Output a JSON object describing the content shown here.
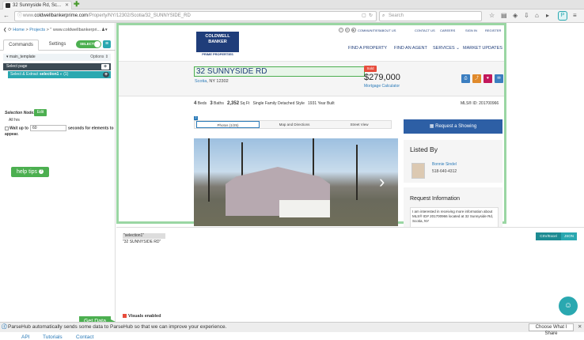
{
  "browser": {
    "tab_title": "32 Sunnyside Rd, Sc...",
    "url_prefix": "www.",
    "url_domain": "coldwellbankerprime.com",
    "url_path": "/Property/NY/12302/Scotia/32_SUNNYSIDE_RD",
    "search_placeholder": "Search"
  },
  "sidebar": {
    "breadcrumb_home": "Home",
    "breadcrumb_sep": " > ",
    "breadcrumb_projects": "Projects",
    "breadcrumb_current": " > \" www.coldwellbankerpri...",
    "tabs": [
      "Commands",
      "Settings"
    ],
    "select_toggle": "SELECT",
    "template_name": "main_template",
    "options_label": "Options ⇕",
    "command_1": "Select page",
    "command_2_prefix": "Select & Extract ",
    "command_2_name": "selection1",
    "command_2_count": "(1)",
    "selection_node_label": "Selection Node:",
    "edit_label": "Edit",
    "all_hrs": "All hrs",
    "wait_label": "Wait up to",
    "wait_value": "60",
    "wait_suffix": "seconds for elements to appear.",
    "help_tips": "help tips",
    "get_data": "Get Data",
    "footer_links": [
      "API",
      "Tutorials",
      "Contact"
    ]
  },
  "site": {
    "logo_line1": "COLDWELL",
    "logo_line2": "BANKER",
    "logo_line3": "PRIME PROPERTIES",
    "top_nav": [
      "COMMUNITIES",
      "ABOUT US",
      "CONTACT US",
      "CAREERS",
      "SIGN IN",
      "REGISTER"
    ],
    "main_nav": [
      "FIND A PROPERTY",
      "FIND AN AGENT",
      "SERVICES ⌄",
      "MARKET UPDATES"
    ],
    "address": "32 SUNNYSIDE RD",
    "city": "Scotia",
    "state_zip": ", NY 12302",
    "sold_badge": "Sold",
    "price": "$279,000",
    "mortgage": "Mortgage Calculator",
    "beds_num": "4",
    "beds_label": "Beds",
    "baths_num": "3",
    "baths_label": "Baths",
    "sqft_num": "2,352",
    "sqft_label": "Sq Ft",
    "type": "Single Family Detached Style",
    "year": "1931 Year Built",
    "mls": "MLS® ID: 201700966",
    "photo_tabs": [
      "Photos (1/25)",
      "Map and Directions",
      "Street View"
    ],
    "photo_badge": "2",
    "showing_btn": "Request a Showing",
    "listed_by": "Listed By",
    "agent_name": "Bonnie Sindel",
    "agent_phone": "518-640-4312",
    "request_info": "Request Information",
    "request_text": "I am interested in receiving more information about MLS® ID# 201700966 located at 32 Sunnyside Rd, Scotia, NY"
  },
  "preview": {
    "key": "\"selection1\"",
    "value": "\"32 SUNNYSIDE RD\"",
    "csv_label": "CSV/Excel",
    "json_label": "JSON",
    "visuals": "Visuals enabled"
  },
  "notice": {
    "text": "ParseHub automatically sends some data to ParseHub so that we can improve your experience.",
    "share": "Choose What I Share"
  },
  "colors": {
    "accent": "#2aa8b0",
    "green": "#4caf50",
    "brand": "#1f3d7a"
  }
}
